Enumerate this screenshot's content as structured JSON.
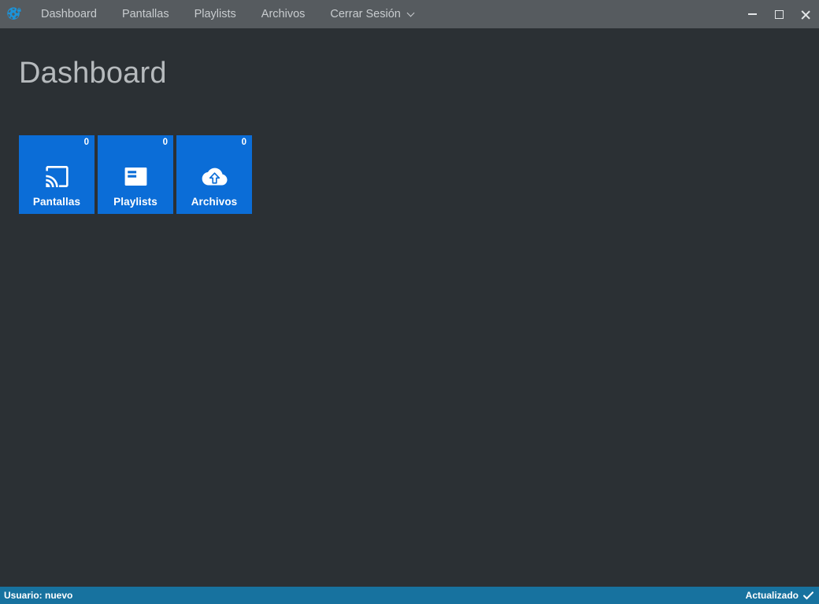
{
  "window": {
    "title": "Dashboard",
    "logo_icon": "globe-lock-icon",
    "controls": {
      "minimize_label": "Minimizar",
      "minimize_icon": "minimize-icon",
      "maximize_label": "Maximizar",
      "maximize_icon": "maximize-icon",
      "close_label": "Cerrar",
      "close_icon": "close-icon"
    }
  },
  "nav": {
    "items": [
      {
        "label": "Dashboard",
        "has_caret": false
      },
      {
        "label": "Pantallas",
        "has_caret": false
      },
      {
        "label": "Playlists",
        "has_caret": false
      },
      {
        "label": "Archivos",
        "has_caret": false
      },
      {
        "label": "Cerrar Sesión",
        "has_caret": true,
        "caret_icon": "chevron-down-icon"
      }
    ]
  },
  "main": {
    "page_title": "Dashboard",
    "tiles": [
      {
        "label": "Pantallas",
        "count": "0",
        "icon": "cast-screen-icon"
      },
      {
        "label": "Playlists",
        "count": "0",
        "icon": "playlist-card-icon"
      },
      {
        "label": "Archivos",
        "count": "0",
        "icon": "cloud-upload-icon"
      }
    ]
  },
  "statusbar": {
    "user_text": "Usuario: nuevo",
    "sync_text": "Actualizado",
    "sync_icon": "checkmark-icon"
  },
  "colors": {
    "titlebar": "#565b5f",
    "background": "#2b3034",
    "tile_blue": "#0b6dd7",
    "statusbar": "#17729f",
    "accent_logo": "#1c93d8",
    "nav_text": "#c8cccf",
    "title_text": "#b6babd"
  }
}
